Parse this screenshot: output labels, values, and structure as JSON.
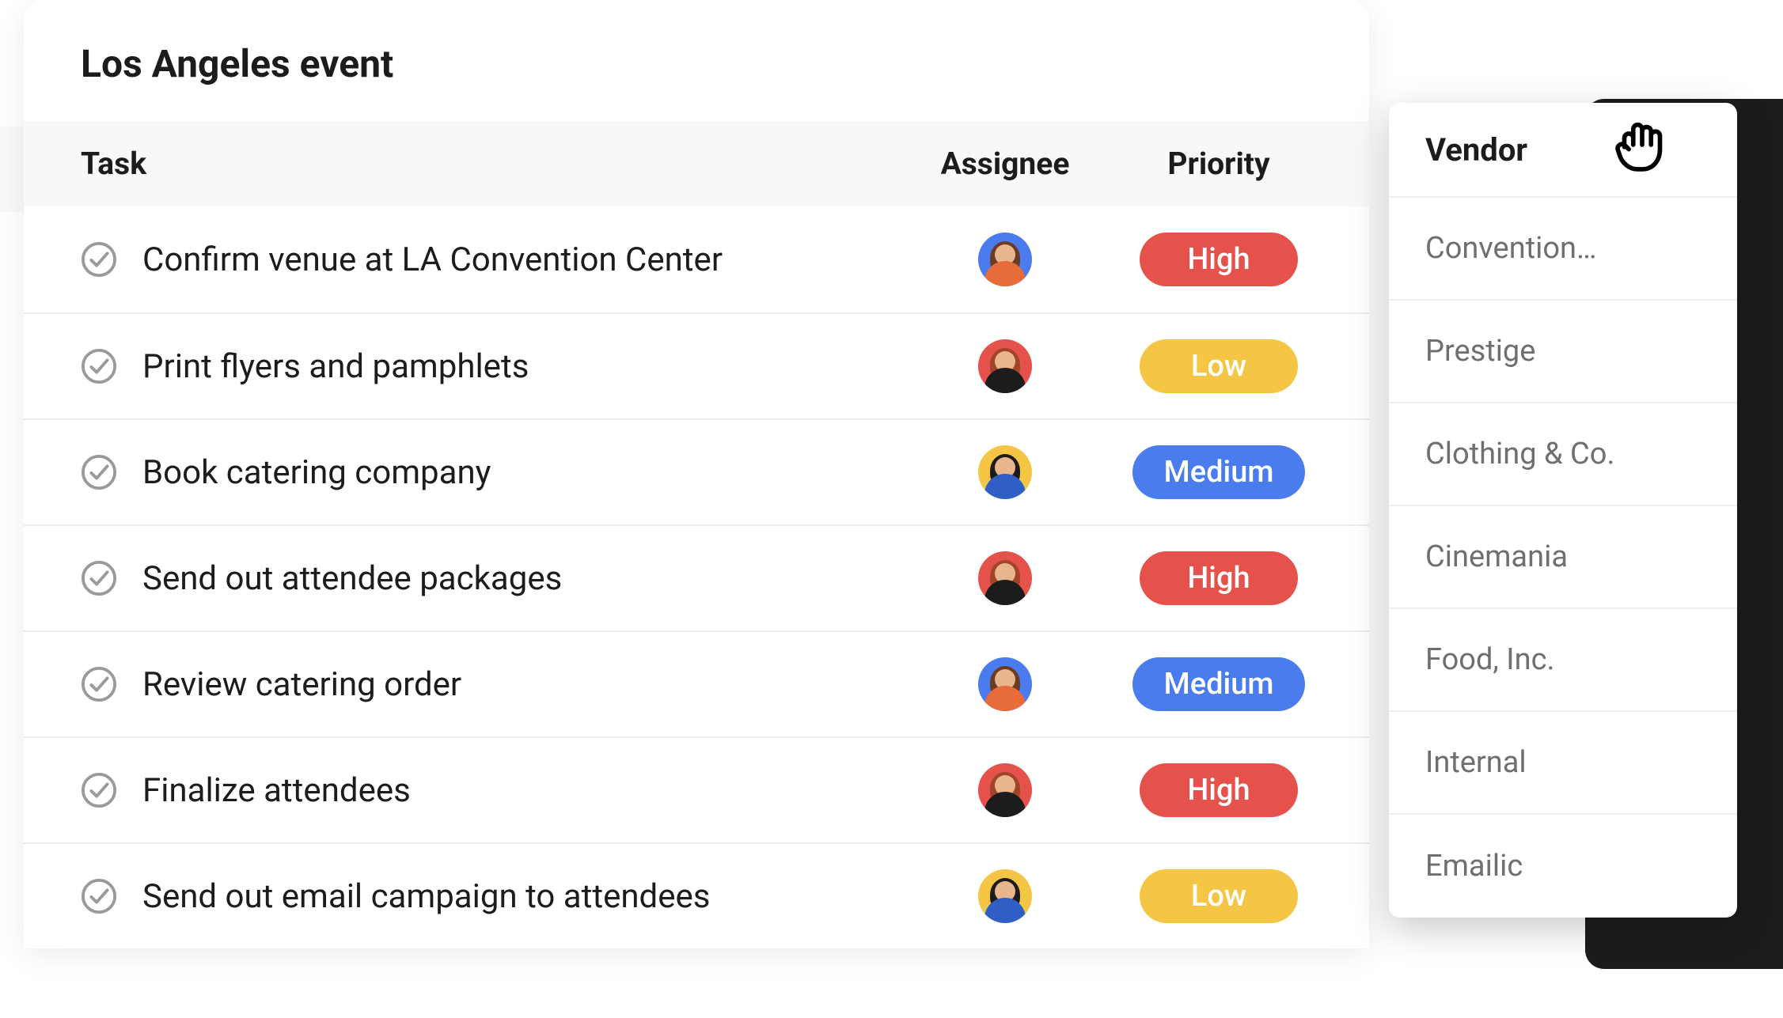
{
  "title": "Los Angeles event",
  "columns": {
    "task": "Task",
    "assignee": "Assignee",
    "priority": "Priority"
  },
  "priority_colors": {
    "High": "#e5514b",
    "Medium": "#4a7ced",
    "Low": "#f5c645"
  },
  "avatars": {
    "a": {
      "bg": "#4a7ced",
      "hair": "#6b3b24",
      "shirt": "#e86b3a"
    },
    "b": {
      "bg": "#e5514b",
      "hair": "#a0452a",
      "shirt": "#1d1c1d"
    },
    "c": {
      "bg": "#f5c645",
      "hair": "#1d1c1d",
      "shirt": "#2f5ec4"
    }
  },
  "tasks": [
    {
      "name": "Confirm venue at LA Convention Center",
      "assignee": "a",
      "priority": "High"
    },
    {
      "name": "Print flyers and pamphlets",
      "assignee": "b",
      "priority": "Low"
    },
    {
      "name": "Book catering company",
      "assignee": "c",
      "priority": "Medium"
    },
    {
      "name": "Send out attendee packages",
      "assignee": "b",
      "priority": "High"
    },
    {
      "name": "Review catering order",
      "assignee": "a",
      "priority": "Medium"
    },
    {
      "name": "Finalize attendees",
      "assignee": "b",
      "priority": "High"
    },
    {
      "name": "Send out email campaign to attendees",
      "assignee": "c",
      "priority": "Low"
    }
  ],
  "vendor": {
    "header": "Vendor",
    "items": [
      "Convention…",
      "Prestige",
      "Clothing & Co.",
      "Cinemania",
      "Food, Inc.",
      "Internal",
      "Emailic"
    ]
  }
}
